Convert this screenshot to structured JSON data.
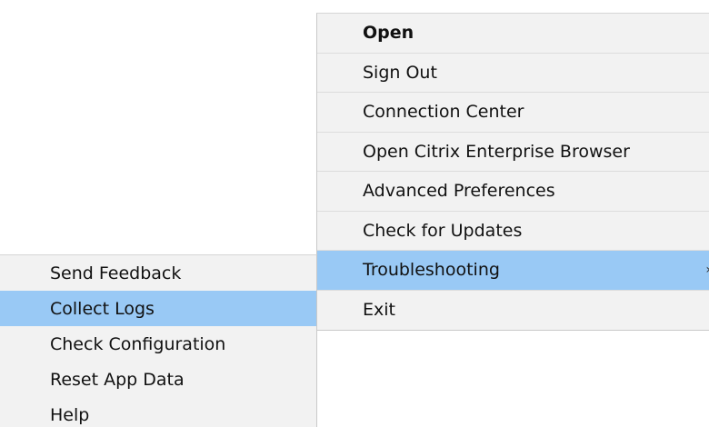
{
  "main_menu": {
    "items": [
      {
        "label": "Open"
      },
      {
        "label": "Sign Out"
      },
      {
        "label": "Connection Center"
      },
      {
        "label": "Open Citrix Enterprise Browser"
      },
      {
        "label": "Advanced Preferences"
      },
      {
        "label": "Check for Updates"
      },
      {
        "label": "Troubleshooting",
        "arrow": "›"
      },
      {
        "label": "Exit"
      }
    ]
  },
  "troubleshooting_submenu": {
    "items": [
      {
        "label": "Send Feedback"
      },
      {
        "label": "Collect Logs"
      },
      {
        "label": "Check Configuration"
      },
      {
        "label": "Reset App Data"
      },
      {
        "label": "Help"
      }
    ]
  },
  "colors": {
    "menu_background": "#f2f2f2",
    "highlight": "#99c9f5",
    "separator": "#dcdcdc"
  },
  "icons": {
    "submenu_indicator": "chevron-right-icon"
  }
}
